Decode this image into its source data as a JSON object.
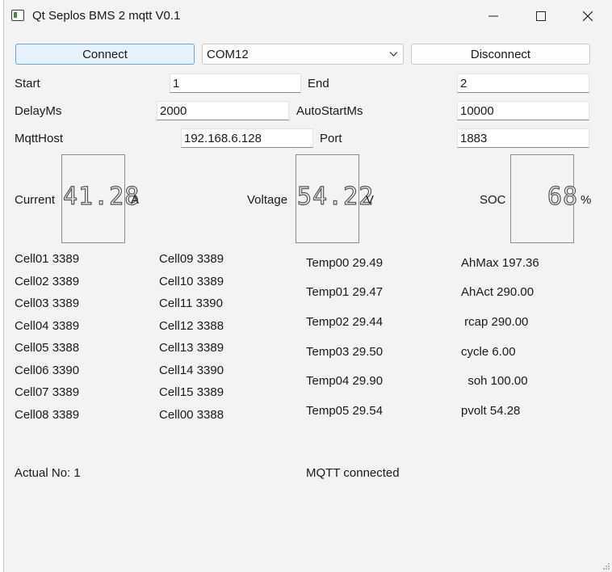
{
  "window": {
    "title": "Qt Seplos BMS 2 mqtt V0.1",
    "controls": [
      "minimize-icon",
      "maximize-icon",
      "close-icon"
    ]
  },
  "toolbar": {
    "connect_label": "Connect",
    "port_value": "COM12",
    "disconnect_label": "Disconnect"
  },
  "settings": {
    "start_label": "Start",
    "start_value": "1",
    "end_label": "End",
    "end_value": "2",
    "delay_label": "DelayMs",
    "delay_value": "2000",
    "autostart_label": "AutoStartMs",
    "autostart_value": "10000",
    "host_label": "MqttHost",
    "host_value": "192.168.6.128",
    "port_label": "Port",
    "port_value": "1883"
  },
  "meters": {
    "current": {
      "label": "Current",
      "value": "41.28",
      "unit": "A"
    },
    "voltage": {
      "label": "Voltage",
      "value": "54.22",
      "unit": "V"
    },
    "soc": {
      "label": "SOC",
      "value": "68",
      "unit": "%"
    }
  },
  "cells_col1": [
    "Cell01 3389",
    "Cell02 3389",
    "Cell03 3389",
    "Cell04 3389",
    "Cell05 3388",
    "Cell06 3390",
    "Cell07 3389",
    "Cell08 3389"
  ],
  "cells_col2": [
    "Cell09 3389",
    "Cell10 3389",
    "Cell11 3390",
    "Cell12 3388",
    "Cell13 3389",
    "Cell14 3390",
    "Cell15 3389",
    "Cell00 3388"
  ],
  "temps": [
    "Temp00 29.49",
    "Temp01 29.47",
    "Temp02 29.44",
    "Temp03 29.50",
    "Temp04 29.90",
    "Temp05 29.54"
  ],
  "stats": [
    "AhMax 197.36",
    "AhAct 290.00",
    " rcap 290.00",
    "cycle 6.00",
    "  soh 100.00",
    "pvolt 54.28"
  ],
  "status": {
    "actual": "Actual No: 1",
    "mqtt": "MQTT connected"
  },
  "colors": {
    "accent": "#e5f1fb",
    "accent_border": "#6ea3d7",
    "window_bg": "#f3f3f3"
  }
}
